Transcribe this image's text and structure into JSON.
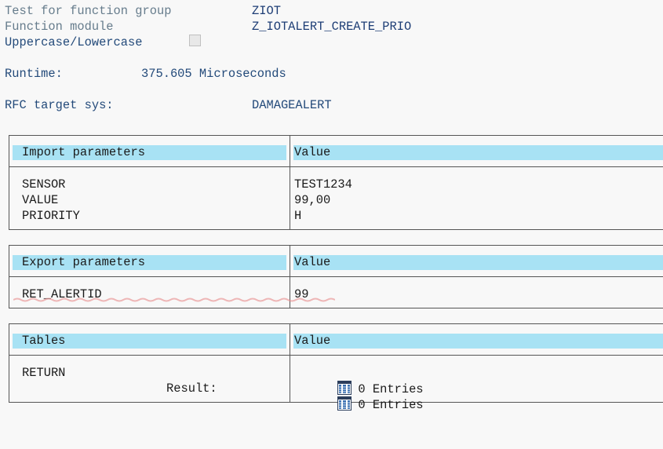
{
  "header": {
    "test_label": "Test for function group",
    "test_value": "ZIOT",
    "module_label": "Function module",
    "module_value": "Z_IOTALERT_CREATE_PRIO",
    "case_label": "Uppercase/Lowercase",
    "case_checked": false
  },
  "runtime": {
    "label": "Runtime:",
    "value": "375.605 Microseconds"
  },
  "rfc": {
    "label": "RFC target sys:",
    "value": "DAMAGEALERT"
  },
  "import": {
    "header": "Import parameters",
    "value_header": "Value",
    "rows": [
      {
        "name": "SENSOR",
        "value": "TEST1234"
      },
      {
        "name": "VALUE",
        "value": "99,00"
      },
      {
        "name": "PRIORITY",
        "value": "H"
      }
    ]
  },
  "export": {
    "header": "Export parameters",
    "value_header": "Value",
    "rows": [
      {
        "name": "RET_ALERTID",
        "value": "99"
      }
    ]
  },
  "tables": {
    "header": "Tables",
    "value_header": "Value",
    "row_name": "RETURN",
    "result_label": "Result:",
    "input_entries": "0 Entries",
    "result_entries": "0 Entries",
    "icon": "table-icon"
  },
  "colors": {
    "header_bg": "#a8e2f4",
    "meta_text": "#667c8c",
    "value_text": "#1d3d75"
  }
}
